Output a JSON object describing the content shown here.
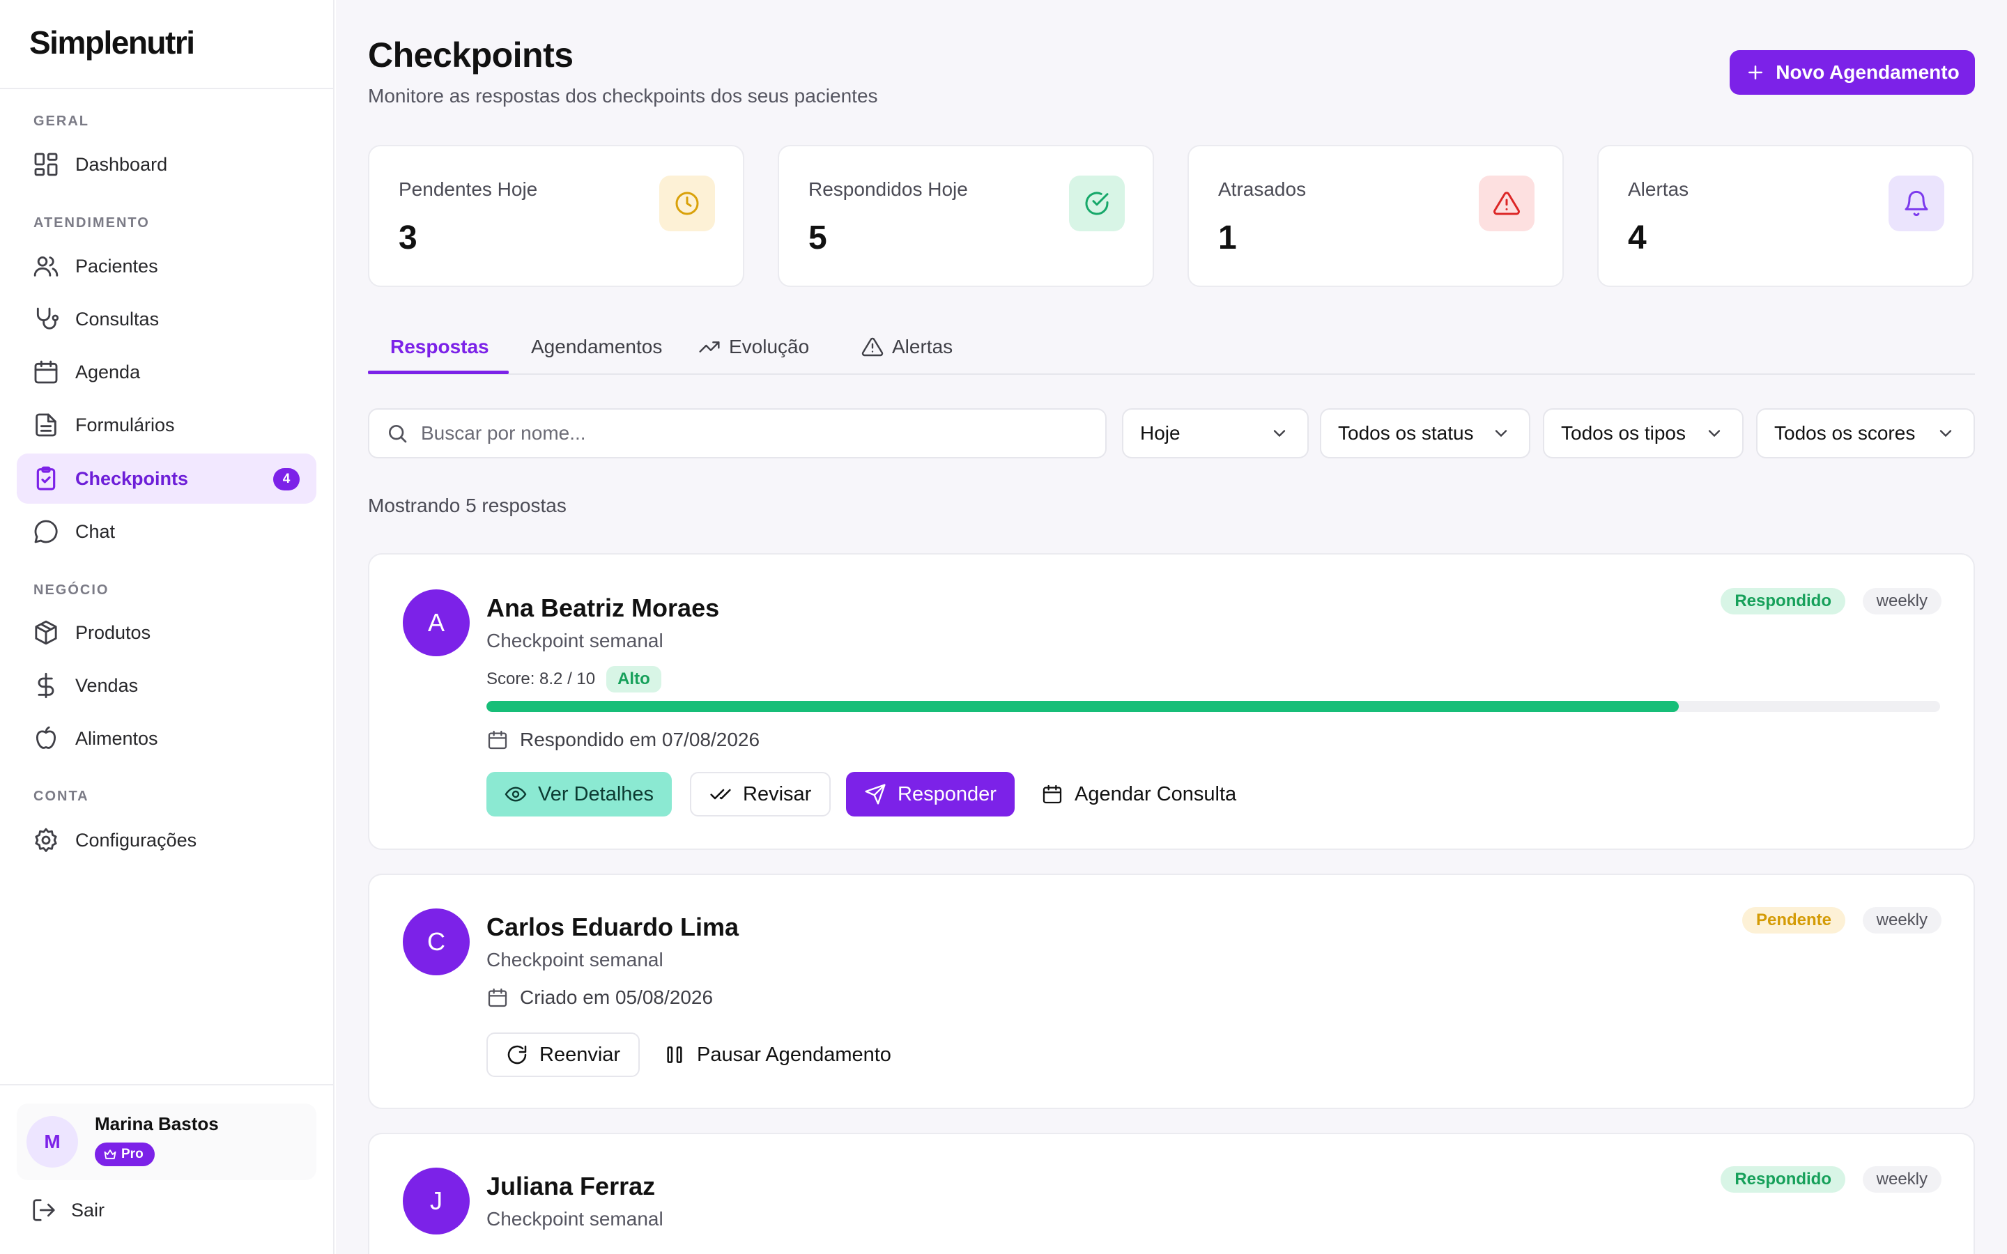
{
  "sidebar": {
    "logo": "Simplenutri",
    "sections": {
      "geral": "GERAL",
      "atendimento": "ATENDIMENTO",
      "negocio": "NEGÓCIO",
      "conta": "CONTA"
    },
    "items": {
      "dashboard": "Dashboard",
      "pacientes": "Pacientes",
      "consultas": "Consultas",
      "agenda": "Agenda",
      "formularios": "Formulários",
      "checkpoints": "Checkpoints",
      "checkpoints_badge": "4",
      "chat": "Chat",
      "produtos": "Produtos",
      "vendas": "Vendas",
      "alimentos": "Alimentos",
      "configuracoes": "Configurações"
    },
    "user": {
      "initial": "M",
      "name": "Marina Bastos",
      "plan": "Pro"
    },
    "logout": "Sair"
  },
  "header": {
    "title": "Checkpoints",
    "subtitle": "Monitore as respostas dos checkpoints dos seus pacientes",
    "new_button": "Novo Agendamento"
  },
  "stats": [
    {
      "label": "Pendentes Hoje",
      "value": "3",
      "icon": "clock-icon",
      "color": "#d9a10a"
    },
    {
      "label": "Respondidos Hoje",
      "value": "5",
      "icon": "check-circle-icon",
      "color": "#17a86a"
    },
    {
      "label": "Atrasados",
      "value": "1",
      "icon": "alert-triangle-icon",
      "color": "#dc2626"
    },
    {
      "label": "Alertas",
      "value": "4",
      "icon": "bell-icon",
      "color": "#7c3aed"
    }
  ],
  "tabs": {
    "respostas": "Respostas",
    "agendamentos": "Agendamentos",
    "evolucao": "Evolução",
    "alertas": "Alertas"
  },
  "filters": {
    "search_placeholder": "Buscar por nome...",
    "period": "Hoje",
    "status": "Todos os status",
    "types": "Todos os tipos",
    "scores": "Todos os scores"
  },
  "results_text": "Mostrando 5 respostas",
  "cards": [
    {
      "initial": "A",
      "name": "Ana Beatriz Moraes",
      "type": "Checkpoint semanal",
      "status": "Respondido",
      "frequency": "weekly",
      "score_text": "Score: 8.2 / 10",
      "score_level": "Alto",
      "score_fraction": 0.82,
      "date_text": "Respondido em 07/08/2026",
      "actions": {
        "details": "Ver Detalhes",
        "review": "Revisar",
        "respond": "Responder",
        "schedule": "Agendar Consulta"
      }
    },
    {
      "initial": "C",
      "name": "Carlos Eduardo Lima",
      "type": "Checkpoint semanal",
      "status": "Pendente",
      "frequency": "weekly",
      "date_text": "Criado em 05/08/2026",
      "actions": {
        "resend": "Reenviar",
        "pause": "Pausar Agendamento"
      }
    },
    {
      "initial": "J",
      "name": "Juliana Ferraz",
      "type": "Checkpoint semanal",
      "status": "Respondido",
      "frequency": "weekly"
    }
  ],
  "colors": {
    "accent": "#7c22e8",
    "success": "#17be78",
    "warning": "#d49b06",
    "danger": "#dc2626"
  }
}
